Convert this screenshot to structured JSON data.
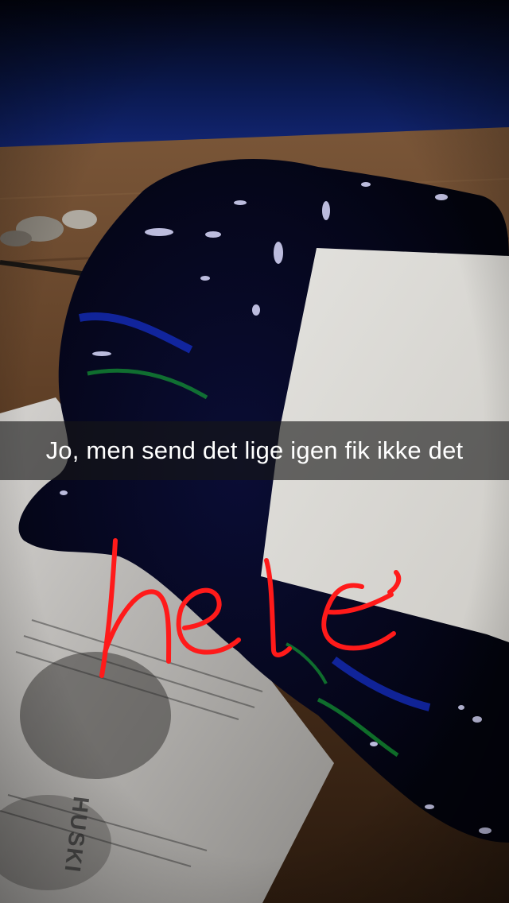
{
  "snap": {
    "caption": "Jo, men send det lige igen fik ikke det",
    "drawing": {
      "text": "hele",
      "color": "#ff1a1a"
    }
  },
  "scene": {
    "card": {
      "brand": "HUSKI"
    }
  },
  "colors": {
    "table": "#5a3a22",
    "floor": "#0d1a4a",
    "object": "#06071e",
    "paper": "#d8d6d2",
    "caption_bg": "#161616"
  }
}
